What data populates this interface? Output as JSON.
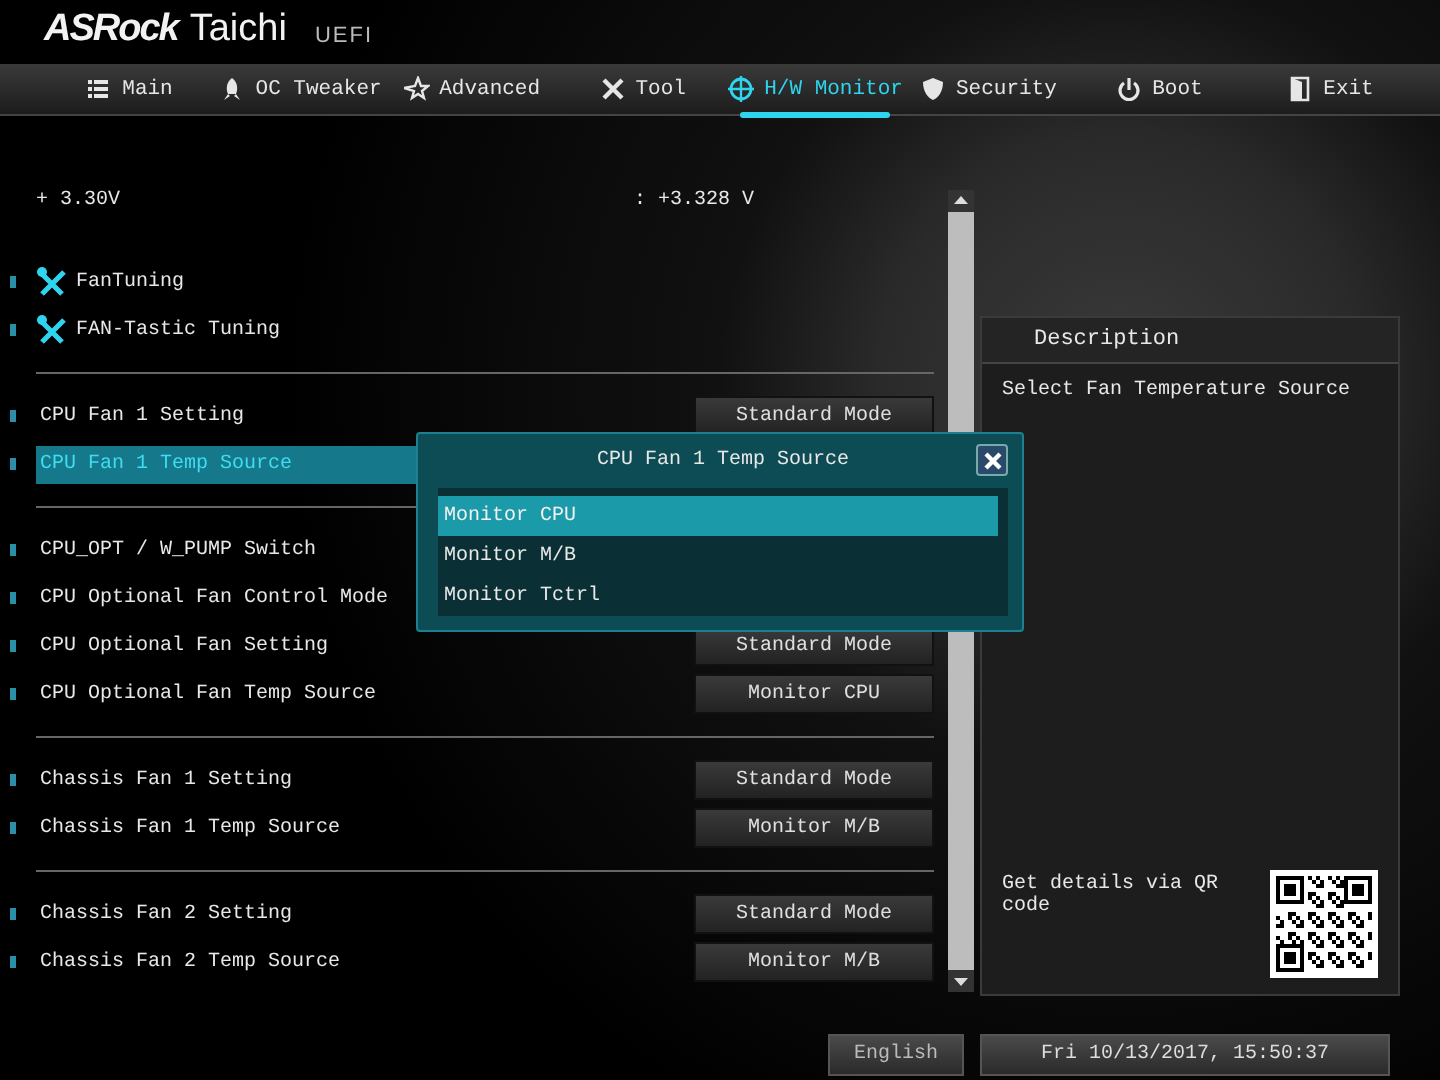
{
  "header": {
    "brand": "ASRock",
    "model": "Taichi",
    "suffix": "UEFI"
  },
  "tabs": [
    {
      "label": "Main",
      "selected": false
    },
    {
      "label": "OC Tweaker",
      "selected": false
    },
    {
      "label": "Advanced",
      "selected": false
    },
    {
      "label": "Tool",
      "selected": false
    },
    {
      "label": "H/W Monitor",
      "selected": true
    },
    {
      "label": "Security",
      "selected": false
    },
    {
      "label": "Boot",
      "selected": false
    },
    {
      "label": "Exit",
      "selected": false
    }
  ],
  "voltage": {
    "label": "+ 3.30V",
    "value": ": +3.328 V"
  },
  "tools": [
    {
      "label": "FanTuning"
    },
    {
      "label": "FAN-Tastic Tuning"
    }
  ],
  "sections": [
    {
      "rows": [
        {
          "label": "CPU Fan 1 Setting",
          "value": "Standard Mode",
          "selected": false
        },
        {
          "label": "CPU Fan 1 Temp Source",
          "selected": true
        }
      ]
    },
    {
      "rows": [
        {
          "label": "CPU_OPT / W_PUMP Switch",
          "selected": false
        },
        {
          "label": "CPU Optional Fan Control Mode",
          "selected": false
        },
        {
          "label": "CPU Optional Fan Setting",
          "value": "Standard Mode",
          "selected": false
        },
        {
          "label": "CPU Optional Fan Temp Source",
          "value": "Monitor CPU",
          "selected": false
        }
      ]
    },
    {
      "rows": [
        {
          "label": "Chassis Fan 1 Setting",
          "value": "Standard Mode",
          "selected": false
        },
        {
          "label": "Chassis Fan 1 Temp Source",
          "value": "Monitor M/B",
          "selected": false
        }
      ]
    },
    {
      "rows": [
        {
          "label": "Chassis Fan 2 Setting",
          "value": "Standard Mode",
          "selected": false
        },
        {
          "label": "Chassis Fan 2 Temp Source",
          "value": "Monitor M/B",
          "selected": false
        }
      ]
    }
  ],
  "description": {
    "title": "Description",
    "text": "Select Fan Temperature Source",
    "qr_hint": "Get details via QR code"
  },
  "dialog": {
    "title": "CPU Fan 1 Temp Source",
    "options": [
      {
        "label": "Monitor CPU",
        "selected": true
      },
      {
        "label": "Monitor M/B",
        "selected": false
      },
      {
        "label": "Monitor Tctrl",
        "selected": false
      }
    ]
  },
  "status_bar": {
    "language": "English",
    "datetime": "Fri 10/13/2017, 15:50:37"
  }
}
